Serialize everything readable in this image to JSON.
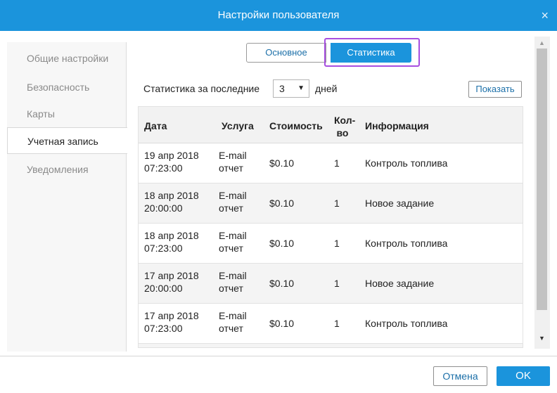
{
  "dialog": {
    "title": "Настройки пользователя",
    "close_glyph": "×",
    "accent_color": "#1b94dc",
    "highlight_color": "#a74fe0"
  },
  "sidebar": {
    "items": [
      {
        "label": "Общие настройки"
      },
      {
        "label": "Безопасность"
      },
      {
        "label": "Карты"
      },
      {
        "label": "Учетная запись"
      },
      {
        "label": "Уведомления"
      }
    ],
    "active": "Учетная запись"
  },
  "tabs": {
    "main": "Основное",
    "stats": "Статистика",
    "selected": "Статистика"
  },
  "filter": {
    "prefix": "Статистика за последние",
    "days_value": "3",
    "suffix": "дней",
    "show_button": "Показать"
  },
  "table": {
    "headers": {
      "date": "Дата",
      "service": "Услуга",
      "cost": "Стоимость",
      "qty_line1": "Кол-",
      "qty_line2": "во",
      "info": "Информация"
    },
    "rows": [
      {
        "date1": "19 апр 2018",
        "date2": "07:23:00",
        "svc1": "E-mail",
        "svc2": "отчет",
        "cost": "$0.10",
        "qty": "1",
        "info": "Контроль топлива"
      },
      {
        "date1": "18 апр 2018",
        "date2": "20:00:00",
        "svc1": "E-mail",
        "svc2": "отчет",
        "cost": "$0.10",
        "qty": "1",
        "info": "Новое задание"
      },
      {
        "date1": "18 апр 2018",
        "date2": "07:23:00",
        "svc1": "E-mail",
        "svc2": "отчет",
        "cost": "$0.10",
        "qty": "1",
        "info": "Контроль топлива"
      },
      {
        "date1": "17 апр 2018",
        "date2": "20:00:00",
        "svc1": "E-mail",
        "svc2": "отчет",
        "cost": "$0.10",
        "qty": "1",
        "info": "Новое задание"
      },
      {
        "date1": "17 апр 2018",
        "date2": "07:23:00",
        "svc1": "E-mail",
        "svc2": "отчет",
        "cost": "$0.10",
        "qty": "1",
        "info": "Контроль топлива"
      }
    ]
  },
  "footer": {
    "cancel": "Отмена",
    "ok": "OK"
  },
  "icons": {
    "close": "close-icon",
    "dropdown": "chevron-down-icon",
    "scroll_up": "scroll-up-arrow-icon",
    "scroll_down": "scroll-down-arrow-icon"
  }
}
